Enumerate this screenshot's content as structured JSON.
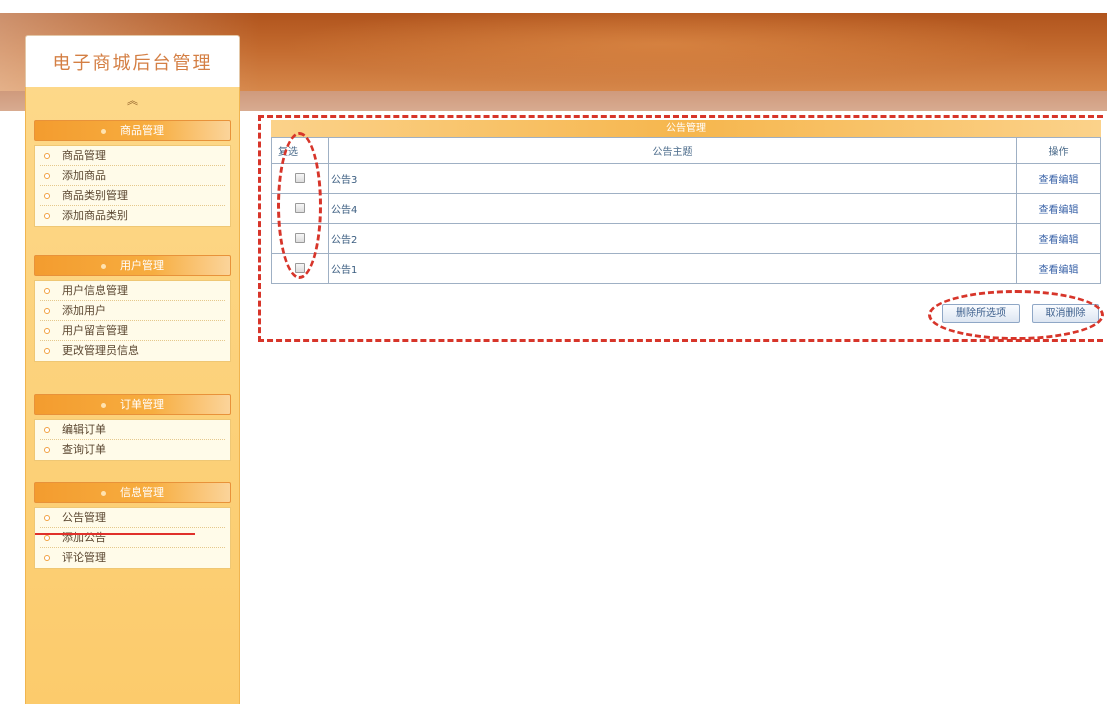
{
  "app": {
    "title": "电子商城后台管理"
  },
  "sidebar": {
    "collapse_icon": "chevron-double-up-icon",
    "collapse_glyph": "︽",
    "sections": [
      {
        "title": "商品管理",
        "items": [
          "商品管理",
          "添加商品",
          "商品类别管理",
          "添加商品类别"
        ]
      },
      {
        "title": "用户管理",
        "items": [
          "用户信息管理",
          "添加用户",
          "用户留言管理",
          "更改管理员信息"
        ]
      },
      {
        "title": "订单管理",
        "items": [
          "编辑订单",
          "查询订单"
        ]
      },
      {
        "title": "信息管理",
        "items": [
          "公告管理",
          "添加公告",
          "评论管理"
        ]
      }
    ],
    "active_item": "公告管理"
  },
  "main": {
    "table_title": "公告管理",
    "columns": {
      "select": "复选",
      "subject": "公告主题",
      "operation": "操作"
    },
    "rows": [
      {
        "subject": "公告3",
        "action": "查看编辑",
        "checked": false
      },
      {
        "subject": "公告4",
        "action": "查看编辑",
        "checked": false
      },
      {
        "subject": "公告2",
        "action": "查看编辑",
        "checked": false
      },
      {
        "subject": "公告1",
        "action": "查看编辑",
        "checked": false
      }
    ],
    "delete_selected_label": "删除所选项",
    "cancel_delete_label": "取消删除"
  },
  "colors": {
    "header_brown": "#b0541d",
    "sidebar_yellow": "#fccb6c",
    "section_orange": "#f39c2f",
    "annotation_red": "#d7352a",
    "link_blue": "#3a63a8"
  }
}
